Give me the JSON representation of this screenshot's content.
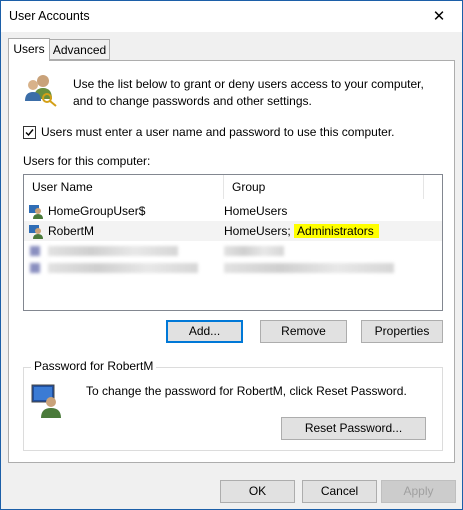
{
  "window": {
    "title": "User Accounts",
    "close_glyph": "✕"
  },
  "tabs": [
    {
      "label": "Users",
      "active": true
    },
    {
      "label": "Advanced",
      "active": false
    }
  ],
  "info": {
    "text": "Use the list below to grant or deny users access to your computer, and to change passwords and other settings.",
    "icon": "users-keys-icon"
  },
  "checkbox": {
    "label": "Users must enter a user name and password to use this computer.",
    "checked": true
  },
  "users_list": {
    "label": "Users for this computer:",
    "columns": [
      "User Name",
      "Group"
    ],
    "rows": [
      {
        "name": "HomeGroupUser$",
        "group": "HomeUsers",
        "group_extra": ""
      },
      {
        "name": "RobertM",
        "group": "HomeUsers;",
        "group_extra": "Administrators"
      }
    ]
  },
  "buttons": {
    "add": "Add...",
    "remove": "Remove",
    "properties": "Properties"
  },
  "password_group": {
    "title": "Password for RobertM",
    "text": "To change the password for RobertM, click Reset Password.",
    "reset_button": "Reset Password...",
    "icon": "user-monitor-icon"
  },
  "footer": {
    "ok": "OK",
    "cancel": "Cancel",
    "apply": "Apply"
  },
  "colors": {
    "highlight": "#ffff00",
    "title_bar": "#ffffff",
    "dialog_bg": "#f0f0f0",
    "accent": "#0078d7"
  }
}
